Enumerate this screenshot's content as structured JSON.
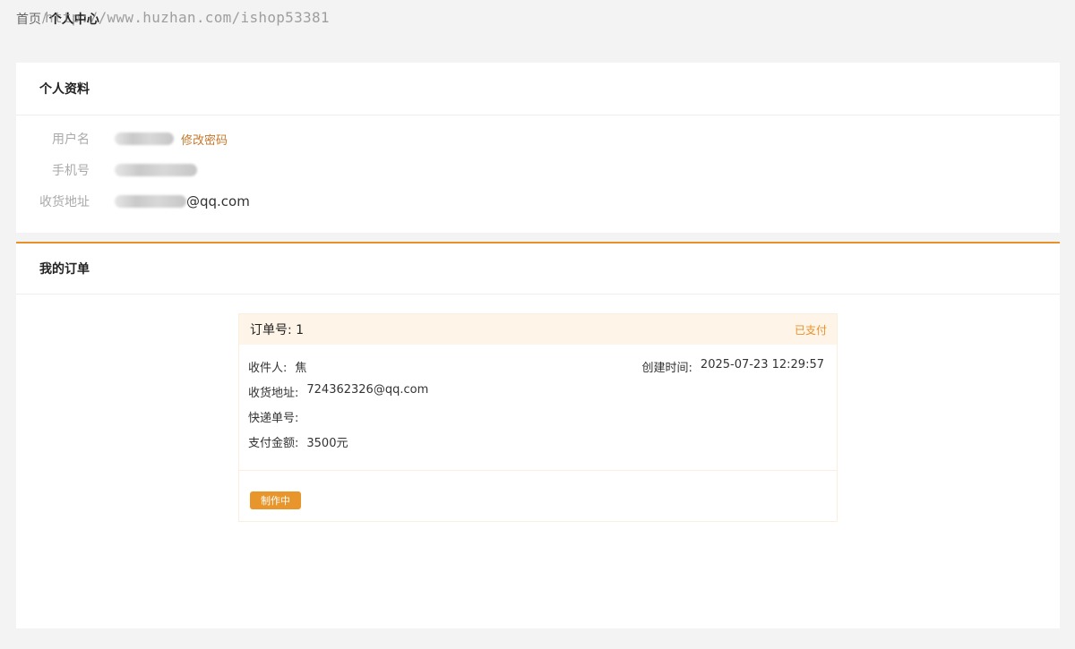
{
  "breadcrumb": {
    "home": "首页",
    "separator": "/",
    "current": "个人中心"
  },
  "watermark": "http://www.huzhan.com/ishop53381",
  "profile": {
    "title": "个人资料",
    "username_label": "用户名",
    "change_password": "修改密码",
    "phone_label": "手机号",
    "address_label": "收货地址",
    "address_tail": "@qq.com"
  },
  "orders": {
    "title": "我的订单",
    "items": [
      {
        "order_no": "订单号: 1",
        "status": "已支付",
        "receiver_label": "收件人:",
        "receiver": "焦",
        "created_label": "创建时间:",
        "created": "2025-07-23 12:29:57",
        "address_label": "收货地址:",
        "address": "724362326@qq.com",
        "tracking_label": "快递单号:",
        "tracking": "",
        "amount_label": "支付金额:",
        "amount": "3500元",
        "state_button": "制作中"
      }
    ]
  },
  "colors": {
    "accent": "#e8912a",
    "link": "#c6772a",
    "order_header_bg": "#fef4e8",
    "page_bg": "#f3f3f3"
  }
}
